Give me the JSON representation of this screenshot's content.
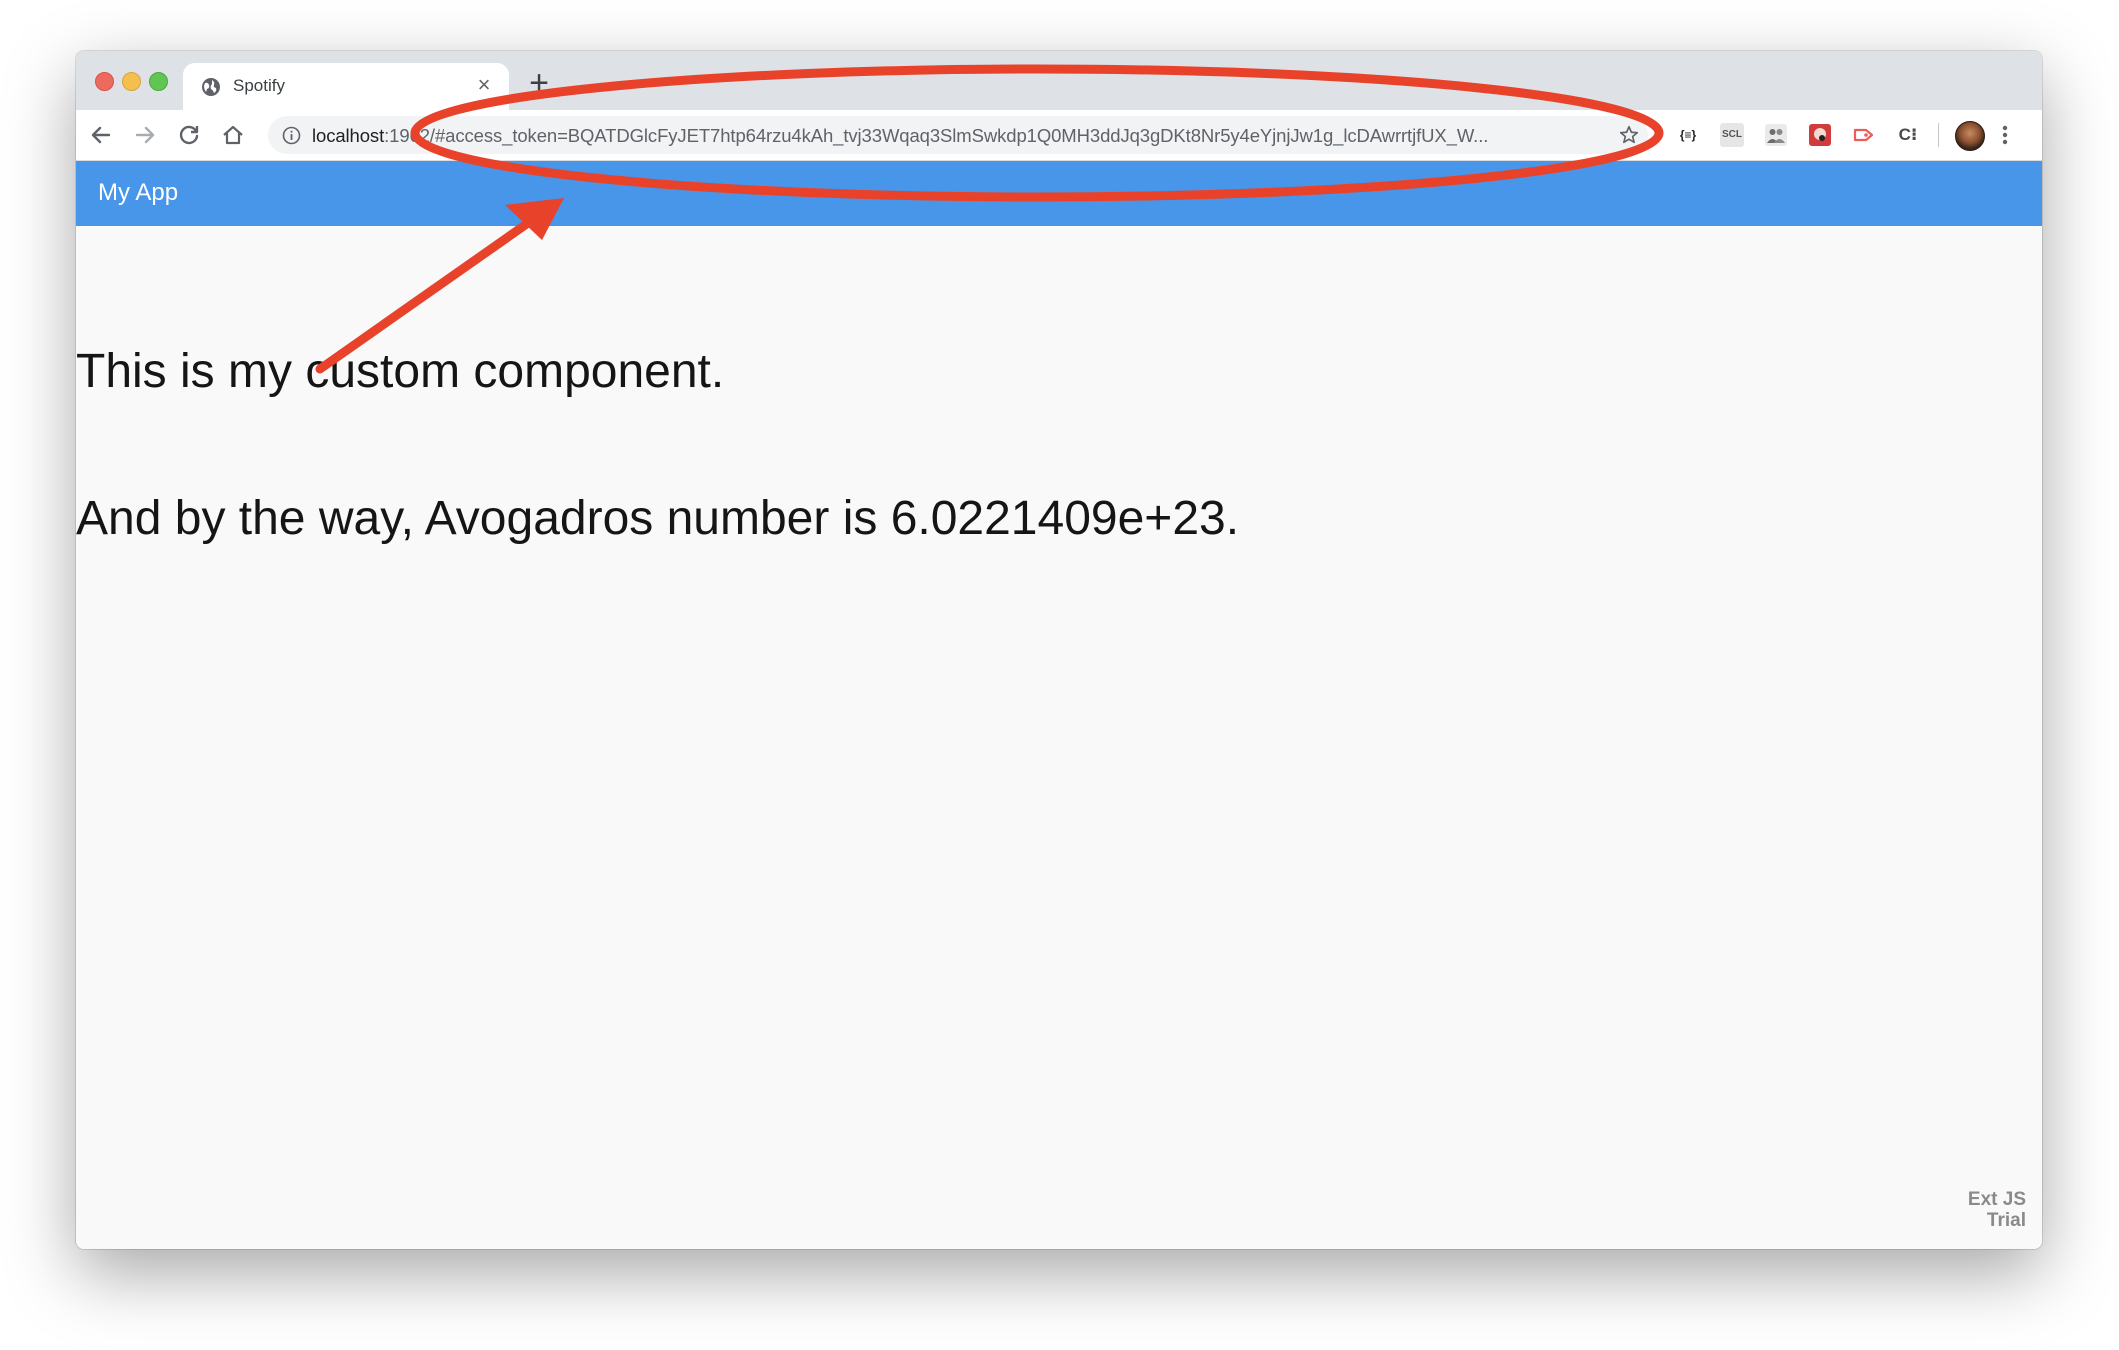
{
  "browser": {
    "tab": {
      "title": "Spotify",
      "close_glyph": "×"
    },
    "new_tab_glyph": "+",
    "url": {
      "host": "localhost",
      "rest": ":1962/#access_token=BQATDGlcFyJET7htp64rzu4kAh_tvj33Wqaq3SlmSwkdp1Q0MH3ddJq3gDKt8Nr5y4eYjnjJw1g_lcDAwrrtjfUX_W..."
    },
    "extensions": [
      {
        "name": "json-formatter-icon",
        "label": "{≡}"
      },
      {
        "name": "scl-icon",
        "label": "SCL"
      },
      {
        "name": "people-icon",
        "label": ""
      },
      {
        "name": "red-extension-icon",
        "label": ""
      },
      {
        "name": "tag-icon",
        "label": ""
      },
      {
        "name": "c-extension-icon",
        "label": "C⁝"
      }
    ]
  },
  "app": {
    "title": "My App",
    "custom_text": "This is my custom component.",
    "avogadro_text": "And by the way, Avogadros number is 6.0221409e+23.",
    "watermark": {
      "line1": "Ext JS",
      "line2": "Trial"
    }
  },
  "colors": {
    "appbar": "#4896ea",
    "annotation": "#e8432a"
  }
}
